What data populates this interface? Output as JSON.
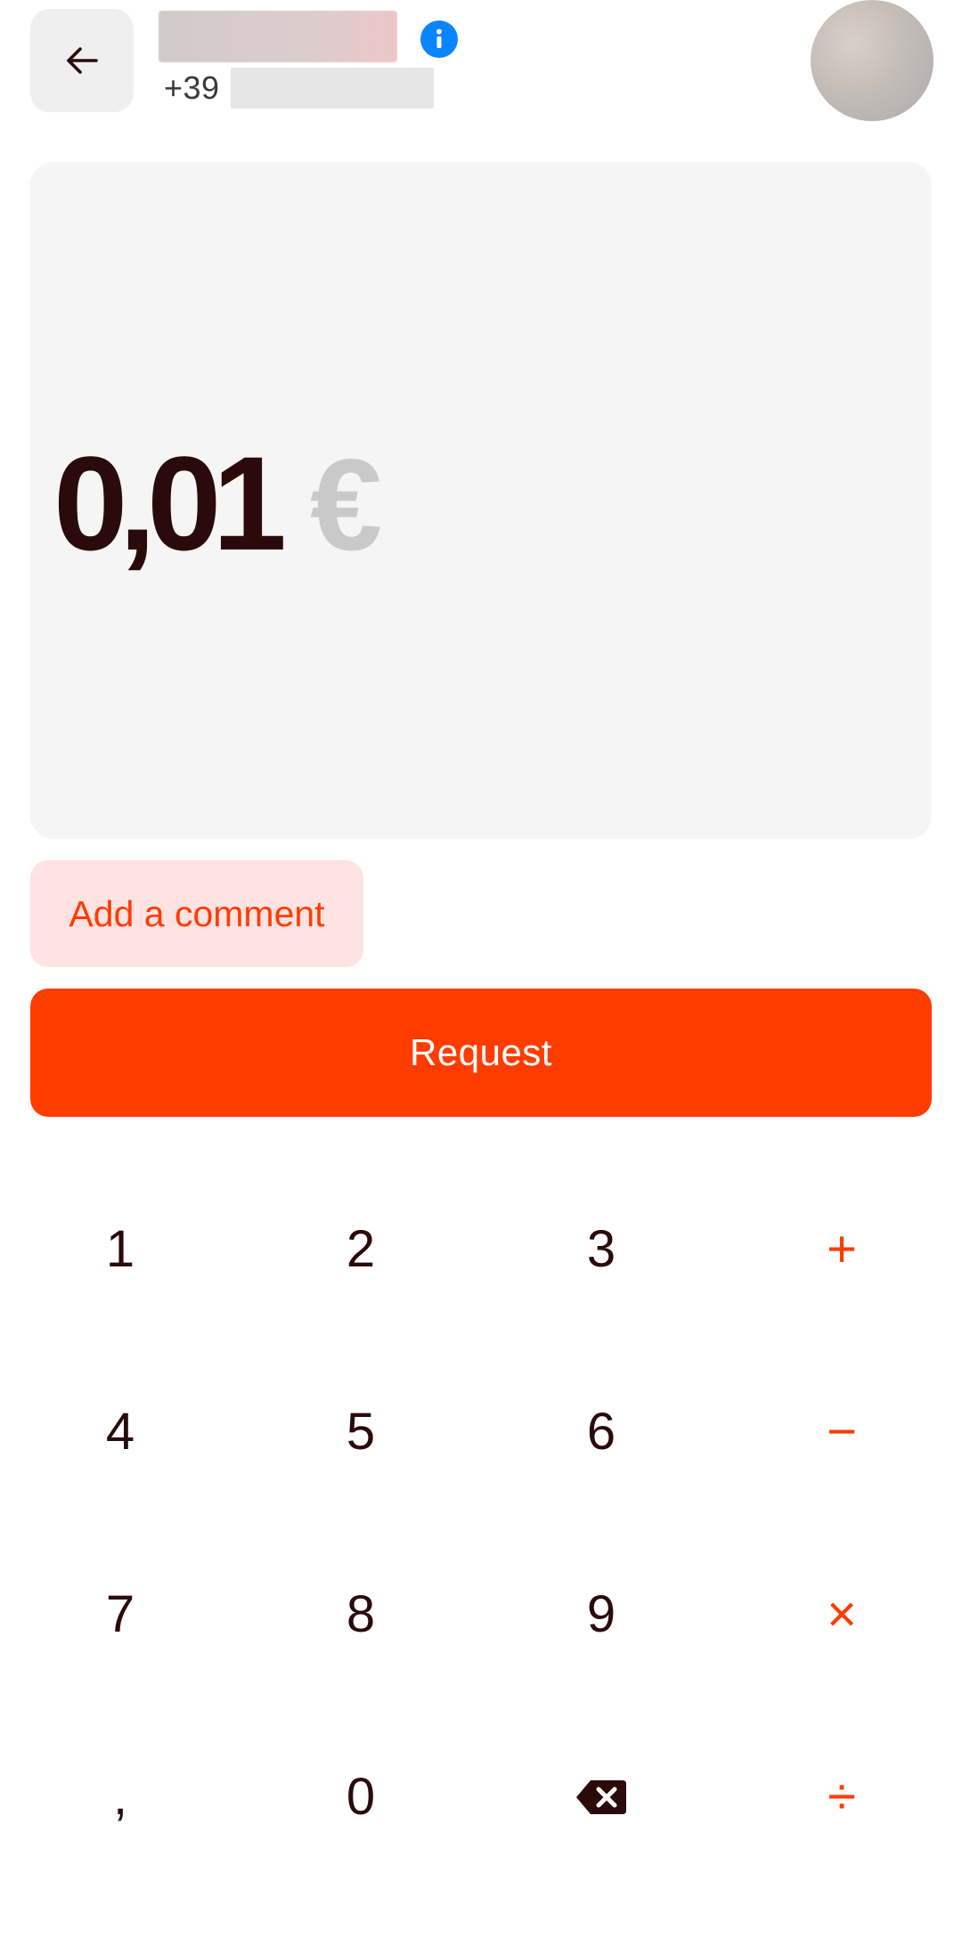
{
  "header": {
    "back_icon": "arrow-left-icon",
    "info_icon": "info-icon",
    "phone_prefix": "+39",
    "avatar_icon": "avatar"
  },
  "amount": {
    "value": "0,01",
    "currency": "€"
  },
  "actions": {
    "comment_label": "Add a comment",
    "request_label": "Request"
  },
  "keypad": {
    "keys": [
      "1",
      "2",
      "3",
      "+",
      "4",
      "5",
      "6",
      "−",
      "7",
      "8",
      "9",
      "×",
      ",",
      "0",
      "backspace-icon",
      "÷"
    ]
  },
  "colors": {
    "accent": "#ff3c00",
    "accent_light": "#ffe3e3",
    "text_dark": "#2a0a0a",
    "info_blue": "#0a84ff",
    "card_bg": "#f5f5f5",
    "currency_gray": "#c9c9c9"
  }
}
